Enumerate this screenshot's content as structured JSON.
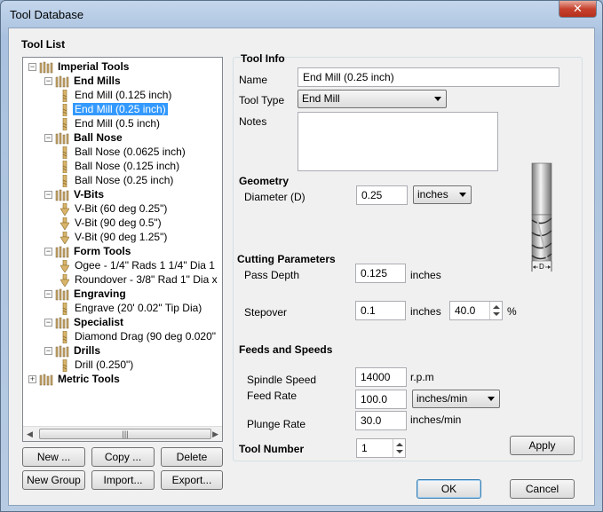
{
  "window": {
    "title": "Tool Database"
  },
  "tool_list": {
    "title": "Tool List",
    "tree": [
      {
        "label": "Imperial Tools",
        "kind": "root",
        "bold": true
      },
      {
        "label": "End Mills",
        "kind": "group",
        "bold": true
      },
      {
        "label": "End Mill (0.125 inch)",
        "kind": "tool"
      },
      {
        "label": "End Mill (0.25 inch)",
        "kind": "tool",
        "selected": true
      },
      {
        "label": "End Mill (0.5 inch)",
        "kind": "tool"
      },
      {
        "label": "Ball Nose",
        "kind": "group",
        "bold": true
      },
      {
        "label": "Ball Nose (0.0625 inch)",
        "kind": "tool"
      },
      {
        "label": "Ball Nose (0.125 inch)",
        "kind": "tool"
      },
      {
        "label": "Ball Nose (0.25 inch)",
        "kind": "tool"
      },
      {
        "label": "V-Bits",
        "kind": "group",
        "bold": true
      },
      {
        "label": "V-Bit (60 deg 0.25\")",
        "kind": "vbit"
      },
      {
        "label": "V-Bit (90 deg 0.5\")",
        "kind": "vbit"
      },
      {
        "label": "V-Bit (90 deg 1.25\")",
        "kind": "vbit"
      },
      {
        "label": "Form Tools",
        "kind": "group",
        "bold": true
      },
      {
        "label": "Ogee - 1/4\" Rads 1 1/4\" Dia 1",
        "kind": "form"
      },
      {
        "label": "Roundover - 3/8\" Rad 1\" Dia x",
        "kind": "form"
      },
      {
        "label": "Engraving",
        "kind": "group",
        "bold": true
      },
      {
        "label": "Engrave (20' 0.02\" Tip Dia)",
        "kind": "tool"
      },
      {
        "label": "Specialist",
        "kind": "group",
        "bold": true
      },
      {
        "label": "Diamond Drag (90 deg 0.020\"",
        "kind": "tool"
      },
      {
        "label": "Drills",
        "kind": "group",
        "bold": true
      },
      {
        "label": "Drill (0.250\")",
        "kind": "tool"
      },
      {
        "label": "Metric Tools",
        "kind": "root",
        "bold": true,
        "collapsed": true
      }
    ],
    "buttons": {
      "new": "New ...",
      "copy": "Copy ...",
      "delete": "Delete",
      "new_group": "New Group",
      "import": "Import...",
      "export": "Export..."
    }
  },
  "tool_info": {
    "title": "Tool Info",
    "name_label": "Name",
    "name_value": "End Mill (0.25 inch)",
    "type_label": "Tool Type",
    "type_value": "End Mill",
    "notes_label": "Notes",
    "notes_value": ""
  },
  "geometry": {
    "title": "Geometry",
    "diameter_label": "Diameter (D)",
    "diameter_value": "0.25",
    "units_value": "inches",
    "diagram_label": "D"
  },
  "cutting": {
    "title": "Cutting Parameters",
    "pass_depth_label": "Pass Depth",
    "pass_depth_value": "0.125",
    "pass_depth_units": "inches",
    "stepover_label": "Stepover",
    "stepover_value": "0.1",
    "stepover_units": "inches",
    "stepover_percent": "40.0",
    "percent_sign": "%"
  },
  "feeds": {
    "title": "Feeds and Speeds",
    "spindle_label": "Spindle Speed",
    "spindle_value": "14000",
    "spindle_units": "r.p.m",
    "feed_label": "Feed Rate",
    "feed_value": "100.0",
    "feed_units": "inches/min",
    "plunge_label": "Plunge Rate",
    "plunge_value": "30.0",
    "plunge_units": "inches/min"
  },
  "tool_number": {
    "label": "Tool Number",
    "value": "1"
  },
  "actions": {
    "apply": "Apply",
    "ok": "OK",
    "cancel": "Cancel"
  }
}
